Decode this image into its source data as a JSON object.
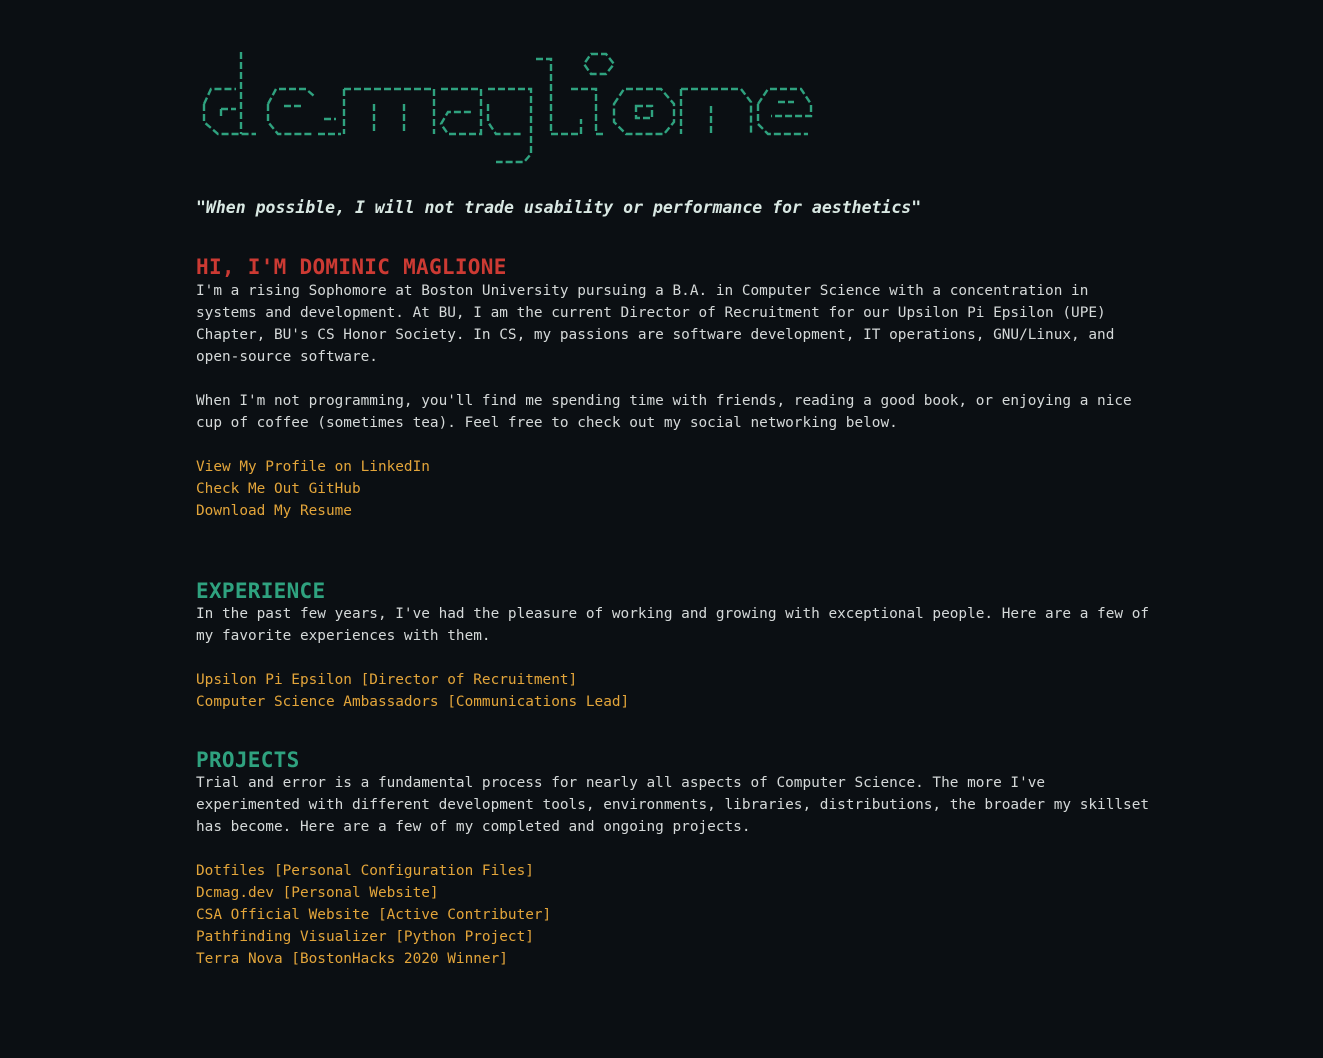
{
  "logo": {
    "text": "dcmaglione",
    "color": "#2fa27f"
  },
  "tagline": "\"When possible, I will not trade usability or performance for aesthetics\"",
  "intro": {
    "title": "HI, I'M DOMINIC MAGLIONE",
    "paragraph_1": "I'm a rising Sophomore at Boston University pursuing a B.A. in Computer Science with a concentration in systems and development. At BU, I am the current Director of Recruitment for our Upsilon Pi Epsilon (UPE) Chapter, BU's CS Honor Society. In CS, my passions are software development, IT operations, GNU/Linux, and open-source software.",
    "paragraph_2": "When I'm not programming, you'll find me spending time with friends, reading a good book, or enjoying a nice cup of coffee (sometimes tea). Feel free to check out my social networking below.",
    "links": [
      "View My Profile on LinkedIn",
      "Check Me Out GitHub",
      "Download My Resume"
    ]
  },
  "experience": {
    "title": "EXPERIENCE",
    "paragraph": "In the past few years, I've had the pleasure of working and growing with exceptional people. Here are a few of my favorite experiences with them.",
    "links": [
      "Upsilon Pi Epsilon [Director of Recruitment]",
      "Computer Science Ambassadors [Communications Lead]"
    ]
  },
  "projects": {
    "title": "PROJECTS",
    "paragraph": "Trial and error is a fundamental process for nearly all aspects of Computer Science. The more I've experimented with different development tools, environments, libraries, distributions, the broader my skillset has become. Here are a few of my completed and ongoing projects.",
    "links": [
      "Dotfiles [Personal Configuration Files]",
      "Dcmag.dev [Personal Website]",
      "CSA Official Website [Active Contributer]",
      "Pathfinding Visualizer [Python Project]",
      "Terra Nova [BostonHacks 2020 Winner]"
    ]
  },
  "colors": {
    "background": "#0b0f13",
    "text": "#d5d9d9",
    "accent_red": "#cc3a33",
    "accent_green": "#2fa27f",
    "link": "#e3a53a"
  }
}
